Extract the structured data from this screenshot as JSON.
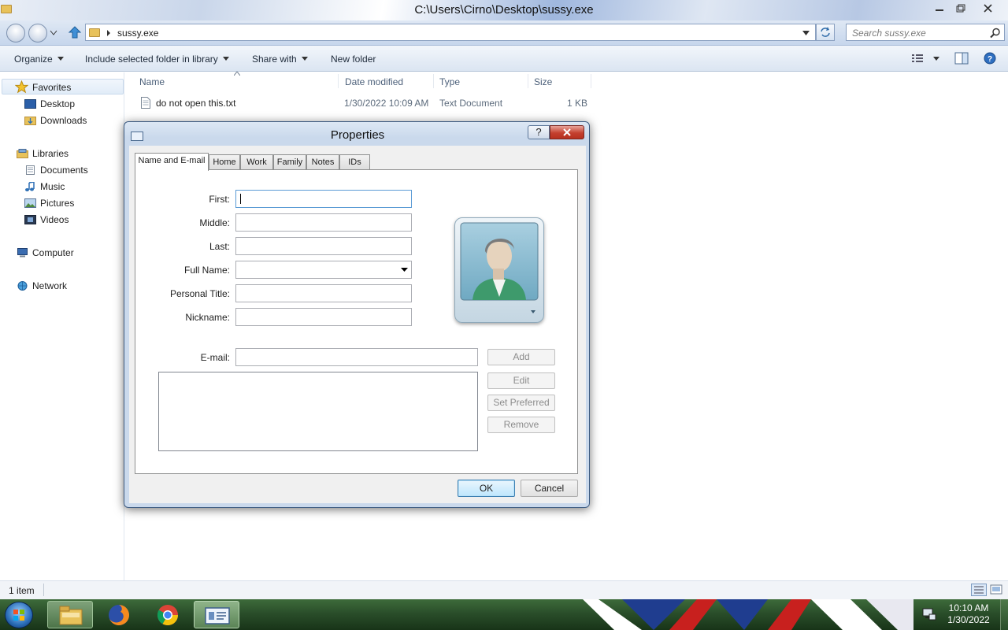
{
  "window": {
    "title": "C:\\Users\\Cirno\\Desktop\\sussy.exe",
    "address_crumb": "sussy.exe",
    "search_placeholder": "Search sussy.exe"
  },
  "toolbar": {
    "organize": "Organize",
    "include": "Include selected folder in library",
    "share": "Share with",
    "new_folder": "New folder"
  },
  "sidebar": {
    "favorites": "Favorites",
    "desktop": "Desktop",
    "downloads": "Downloads",
    "libraries": "Libraries",
    "documents": "Documents",
    "music": "Music",
    "pictures": "Pictures",
    "videos": "Videos",
    "computer": "Computer",
    "network": "Network"
  },
  "columns": {
    "name": "Name",
    "date": "Date modified",
    "type": "Type",
    "size": "Size"
  },
  "files": [
    {
      "name": "do not open this.txt",
      "date": "1/30/2022 10:09 AM",
      "type": "Text Document",
      "size": "1 KB"
    }
  ],
  "status": {
    "count": "1 item"
  },
  "taskbar": {
    "time": "10:10 AM",
    "date": "1/30/2022"
  },
  "dialog": {
    "title": "Properties",
    "help": "?",
    "tabs": [
      "Name and E-mail",
      "Home",
      "Work",
      "Family",
      "Notes",
      "IDs"
    ],
    "labels": {
      "first": "First:",
      "middle": "Middle:",
      "last": "Last:",
      "full_name": "Full Name:",
      "personal_title": "Personal Title:",
      "nickname": "Nickname:",
      "email": "E-mail:"
    },
    "values": {
      "first": "",
      "middle": "",
      "last": "",
      "full_name": "",
      "personal_title": "",
      "nickname": "",
      "email": ""
    },
    "buttons": {
      "add": "Add",
      "edit": "Edit",
      "set_preferred": "Set Preferred",
      "remove": "Remove",
      "ok": "OK",
      "cancel": "Cancel"
    }
  }
}
